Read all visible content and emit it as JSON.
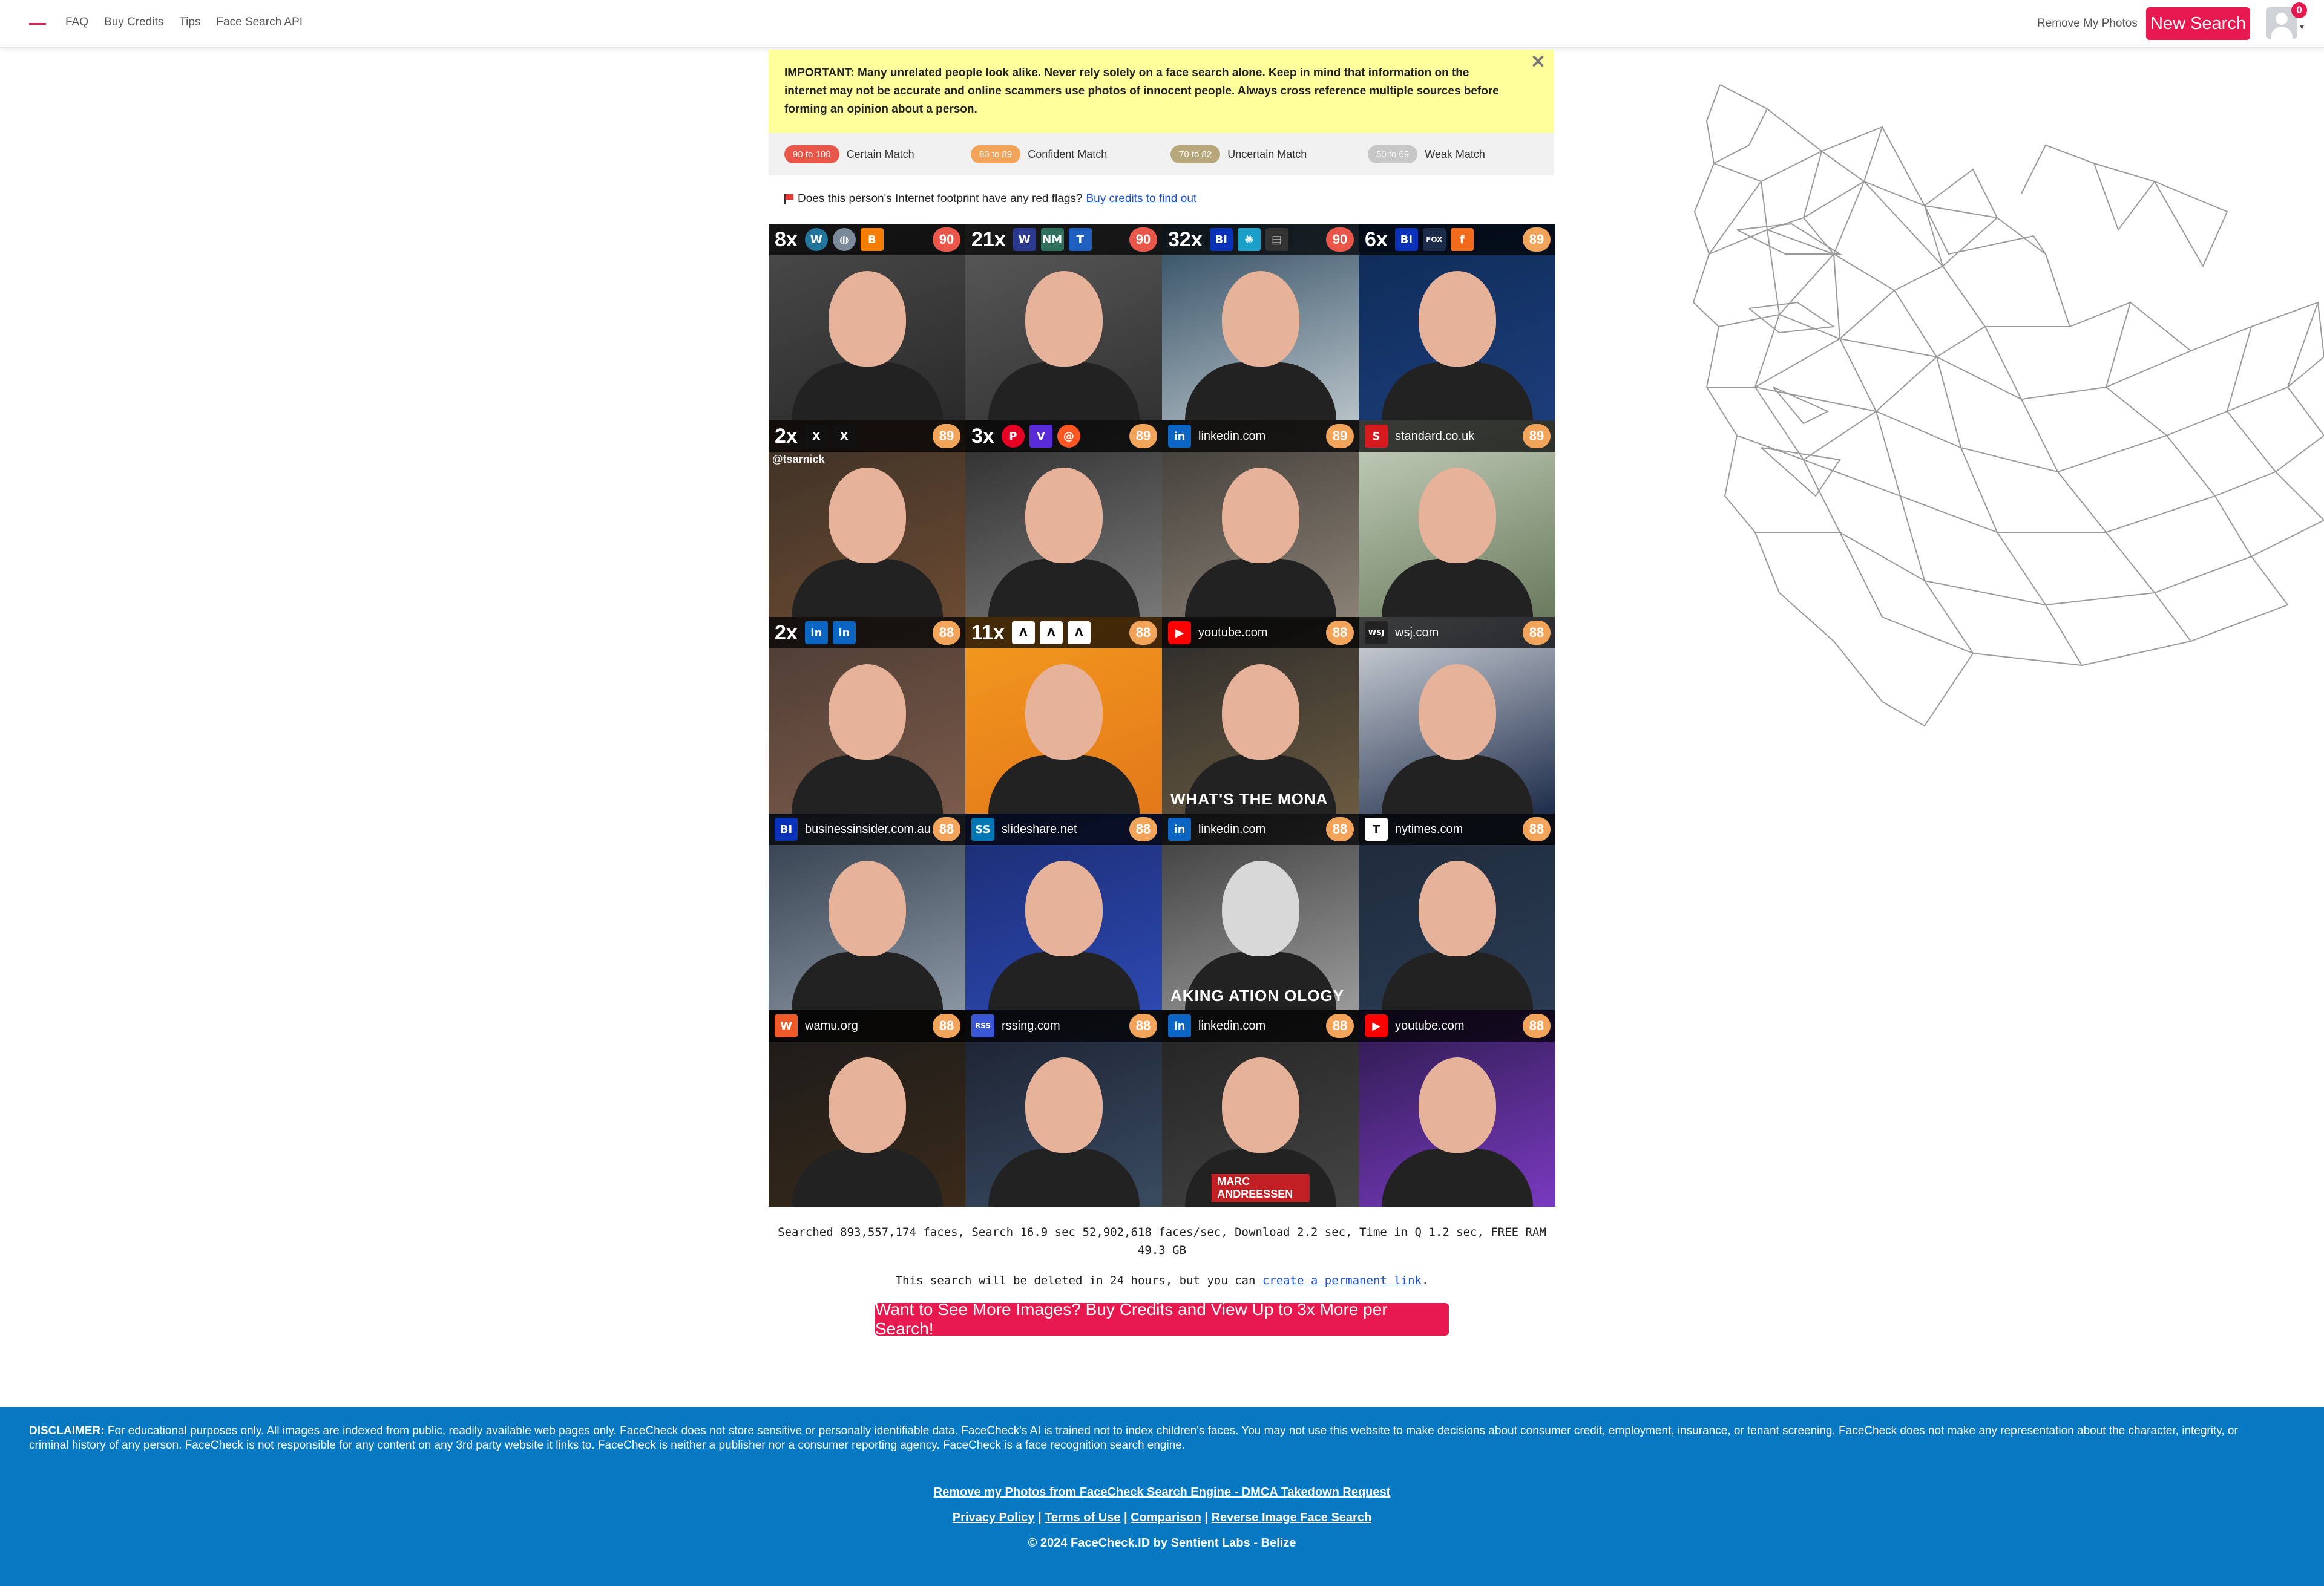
{
  "nav": {
    "links": [
      "FAQ",
      "Buy Credits",
      "Tips",
      "Face Search API"
    ],
    "remove_photos": "Remove My Photos",
    "new_search": "New Search",
    "notification_count": "0"
  },
  "notice": {
    "text": "IMPORTANT: Many unrelated people look alike. Never rely solely on a face search alone. Keep in mind that information on the internet may not be accurate and online scammers use photos of innocent people. Always cross reference multiple sources before forming an opinion about a person."
  },
  "legend": [
    {
      "range": "90 to 100",
      "label": "Certain Match",
      "color": "#e8574a"
    },
    {
      "range": "83 to 89",
      "label": "Confident Match",
      "color": "#f2a55a"
    },
    {
      "range": "70 to 82",
      "label": "Uncertain Match",
      "color": "#b7a77a"
    },
    {
      "range": "50 to 69",
      "label": "Weak Match",
      "color": "#c7c7c7"
    }
  ],
  "red_flag": {
    "question": "Does this person's Internet footprint have any red flags?",
    "link": "Buy credits to find out"
  },
  "results": [
    {
      "count": "8x",
      "score": "90",
      "icons": [
        "wordpress-icon",
        "globe-icon",
        "blogger-icon"
      ]
    },
    {
      "count": "21x",
      "score": "90",
      "icons": [
        "w-icon",
        "nm-icon",
        "t-icon"
      ]
    },
    {
      "count": "32x",
      "score": "90",
      "icons": [
        "bi-icon",
        "brain-icon",
        "news-icon"
      ]
    },
    {
      "count": "6x",
      "score": "89",
      "icons": [
        "bi-icon",
        "fox-icon",
        "f-icon"
      ]
    },
    {
      "count": "2x",
      "score": "89",
      "icons": [
        "x-icon",
        "x-icon"
      ],
      "caption": "@tsarnick"
    },
    {
      "count": "3x",
      "score": "89",
      "icons": [
        "pinterest-icon",
        "v-icon",
        "at-icon"
      ]
    },
    {
      "domain": "linkedin.com",
      "score": "89",
      "icons": [
        "linkedin-icon"
      ]
    },
    {
      "domain": "standard.co.uk",
      "score": "89",
      "icons": [
        "standard-icon"
      ]
    },
    {
      "count": "2x",
      "score": "88",
      "icons": [
        "linkedin-icon",
        "linkedin-icon"
      ]
    },
    {
      "count": "11x",
      "score": "88",
      "icons": [
        "a-icon",
        "a-icon",
        "a-icon"
      ]
    },
    {
      "domain": "youtube.com",
      "score": "88",
      "icons": [
        "youtube-icon"
      ],
      "caption": "WHAT'S THE MONA"
    },
    {
      "domain": "wsj.com",
      "score": "88",
      "icons": [
        "wsj-icon"
      ]
    },
    {
      "domain": "businessinsider.com.au",
      "score": "88",
      "icons": [
        "bi-icon"
      ]
    },
    {
      "domain": "slideshare.net",
      "score": "88",
      "icons": [
        "slideshare-icon"
      ]
    },
    {
      "domain": "linkedin.com",
      "score": "88",
      "icons": [
        "linkedin-icon"
      ],
      "caption": "AKING ATION OLOGY"
    },
    {
      "domain": "nytimes.com",
      "score": "88",
      "icons": [
        "nytimes-icon"
      ]
    },
    {
      "domain": "wamu.org",
      "score": "88",
      "icons": [
        "wamu-icon"
      ]
    },
    {
      "domain": "rssing.com",
      "score": "88",
      "icons": [
        "rss-icon"
      ]
    },
    {
      "domain": "linkedin.com",
      "score": "88",
      "icons": [
        "linkedin-icon"
      ],
      "caption_red": "MARC ANDREESSEN"
    },
    {
      "domain": "youtube.com",
      "score": "88",
      "icons": [
        "youtube-icon"
      ]
    }
  ],
  "stats": {
    "line": "Searched 893,557,174 faces, Search 16.9 sec 52,902,618 faces/sec, Download 2.2 sec, Time in Q 1.2 sec, FREE RAM 49.3 GB"
  },
  "delete_note": {
    "text": "This search will be deleted in 24 hours, but you can",
    "link": "create a permanent link"
  },
  "cta": "Want to See More Images? Buy Credits and View Up to 3x More per Search!",
  "footer": {
    "disclaimer_label": "DISCLAIMER:",
    "disclaimer": "For educational purposes only. All images are indexed from public, readily available web pages only. FaceCheck does not store sensitive or personally identifiable data. FaceCheck's AI is trained not to index children's faces. You may not use this website to make decisions about consumer credit, employment, insurance, or tenant screening. FaceCheck does not make any representation about the character, integrity, or criminal history of any person. FaceCheck is not responsible for any content on any 3rd party website it links to. FaceCheck is neither a publisher nor a consumer reporting agency. FaceCheck is a face recognition search engine.",
    "dmca": "Remove my Photos from FaceCheck Search Engine - DMCA Takedown Request",
    "links": [
      "Privacy Policy",
      "Terms of Use",
      "Comparison",
      "Reverse Image Face Search"
    ],
    "copyright": "© 2024 FaceCheck.ID by Sentient Labs - Belize"
  },
  "colors": {
    "brand": "#e8194f",
    "score_red": "#e8574a",
    "score_orange": "#f2a55a",
    "footer": "#0679c2"
  }
}
